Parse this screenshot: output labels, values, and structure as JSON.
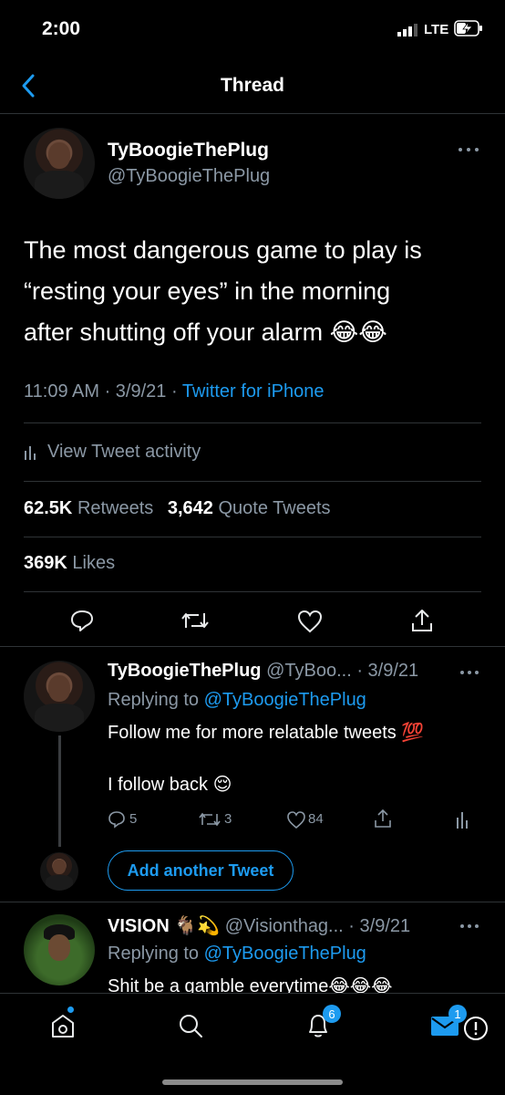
{
  "status_bar": {
    "time": "2:00",
    "network": "LTE"
  },
  "header": {
    "title": "Thread"
  },
  "main_tweet": {
    "display_name": "TyBoogieThePlug",
    "handle": "@TyBoogieThePlug",
    "text_line1": "The most dangerous game to play is",
    "text_line2": "“resting your eyes” in the morning",
    "text_line3": "after shutting off your alarm 😂😂",
    "timestamp": "11:09 AM · 3/9/21 · ",
    "source": "Twitter for iPhone",
    "activity_label": "View Tweet activity",
    "retweets_count": "62.5K",
    "retweets_label": "Retweets",
    "quotes_count": "3,642",
    "quotes_label": "Quote Tweets",
    "likes_count": "369K",
    "likes_label": "Likes"
  },
  "reply1": {
    "display_name": "TyBoogieThePlug",
    "handle": "@TyBoo...",
    "date": "· 3/9/21",
    "replying_label": "Replying to ",
    "replying_to": "@TyBoogieThePlug",
    "text_line1": "Follow me for more relatable tweets 💯",
    "text_line2": "I follow back 😌",
    "reply_count": "5",
    "retweet_count": "3",
    "like_count": "84"
  },
  "add_tweet": {
    "label": "Add another Tweet"
  },
  "reply2": {
    "display_name": "VISION 🐐💫",
    "handle": "@Visionthag...",
    "date": "· 3/9/21",
    "replying_label": "Replying to ",
    "replying_to": "@TyBoogieThePlug",
    "text": "Shit be a gamble everytime😂😂😂"
  },
  "tab_bar": {
    "notifications_badge": "6",
    "messages_badge": "1"
  },
  "colors": {
    "accent": "#1d9bf0",
    "background": "#000000",
    "muted": "#8b98a5"
  }
}
